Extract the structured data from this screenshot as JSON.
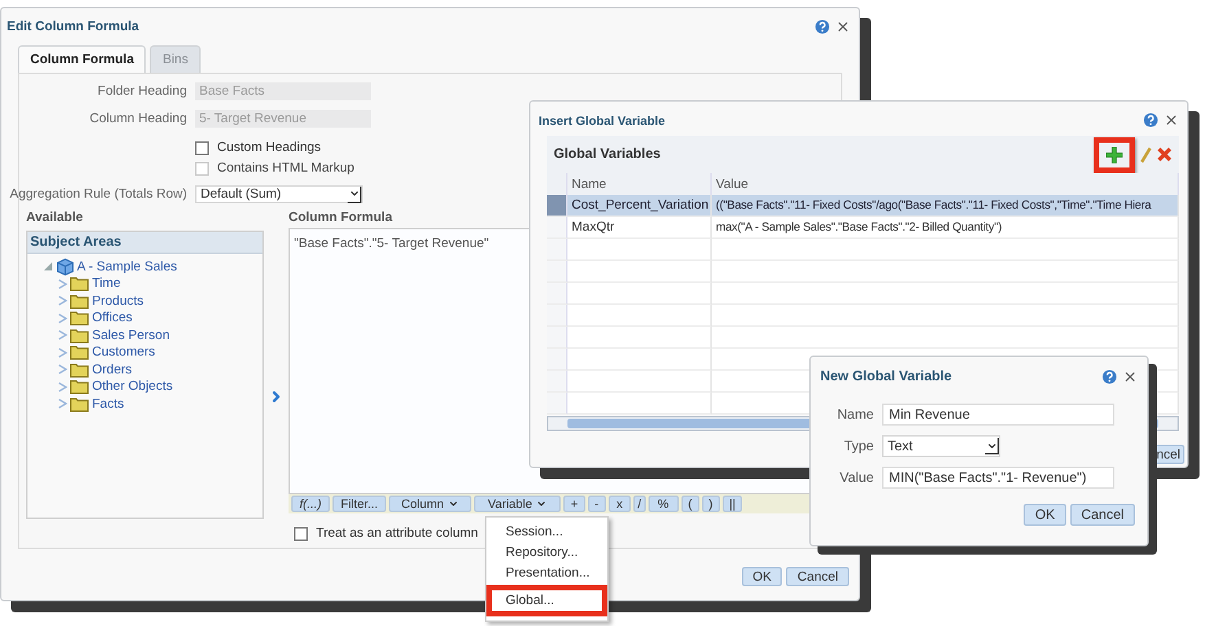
{
  "edit_dialog": {
    "title": "Edit Column Formula",
    "tabs": [
      {
        "label": "Column Formula",
        "selected": true
      },
      {
        "label": "Bins",
        "selected": false
      }
    ],
    "fields": [
      {
        "label": "Folder Heading",
        "value": "Base Facts"
      },
      {
        "label": "Column Heading",
        "value": "5- Target Revenue"
      }
    ],
    "options": [
      {
        "label": "Custom Headings",
        "checked": false,
        "disabled": false
      },
      {
        "label": "Contains HTML Markup",
        "checked": false,
        "disabled": true
      }
    ],
    "aggregation": {
      "label": "Aggregation Rule (Totals Row)",
      "value": "Default (Sum)"
    },
    "available": {
      "label": "Available",
      "tree_title": "Subject Areas",
      "root": {
        "label": "A - Sample Sales",
        "expanded": true,
        "children": [
          {
            "label": "Time",
            "expanded": false
          },
          {
            "label": "Products",
            "expanded": false
          },
          {
            "label": "Offices",
            "expanded": false
          },
          {
            "label": "Sales Person",
            "expanded": false
          },
          {
            "label": "Customers",
            "expanded": false
          },
          {
            "label": "Orders",
            "expanded": false
          },
          {
            "label": "Other Objects",
            "expanded": false
          },
          {
            "label": "Facts",
            "expanded": false
          }
        ]
      }
    },
    "formula": {
      "label": "Column Formula",
      "text": "\"Base Facts\".\"5- Target Revenue\"",
      "toolbar": [
        {
          "label": "f(...)",
          "kind": "italic"
        },
        {
          "label": "Filter...",
          "kind": "plain"
        },
        {
          "label": "Column",
          "kind": "menu"
        },
        {
          "label": "Variable",
          "kind": "menu"
        },
        {
          "label": "+",
          "kind": "plain"
        },
        {
          "label": "-",
          "kind": "plain"
        },
        {
          "label": "x",
          "kind": "plain"
        },
        {
          "label": "/",
          "kind": "plain"
        },
        {
          "label": "%",
          "kind": "plain"
        },
        {
          "label": "(",
          "kind": "plain"
        },
        {
          "label": ")",
          "kind": "plain"
        },
        {
          "label": "||",
          "kind": "plain"
        }
      ]
    },
    "attribute_option": {
      "label": "Treat as an attribute column",
      "checked": false
    },
    "variable_menu": [
      {
        "label": "Session...",
        "highlighted": false
      },
      {
        "label": "Repository...",
        "highlighted": false
      },
      {
        "label": "Presentation...",
        "highlighted": false
      },
      {
        "label": "Global...",
        "highlighted": true
      }
    ],
    "buttons": [
      "OK",
      "Cancel"
    ]
  },
  "insert_dialog": {
    "title": "Insert Global Variable",
    "grid_title": "Global Variables",
    "add_highlighted": true,
    "columns": [
      "Name",
      "Value"
    ],
    "rows": [
      {
        "name": "Cost_Percent_Variation",
        "value": "((\"Base Facts\".\"11- Fixed Costs\"/ago(\"Base Facts\".\"11- Fixed Costs\",\"Time\".\"Time Hiera",
        "selected": true
      },
      {
        "name": "MaxQtr",
        "value": "max(\"A - Sample Sales\".\"Base Facts\".\"2- Billed Quantity\")",
        "selected": false
      }
    ],
    "buttons": [
      "ncel"
    ]
  },
  "new_dialog": {
    "title": "New Global Variable",
    "fields": [
      {
        "label": "Name",
        "value": "Min Revenue",
        "kind": "text"
      },
      {
        "label": "Type",
        "value": "Text",
        "kind": "select"
      },
      {
        "label": "Value",
        "value": "MIN(\"Base Facts\".\"1- Revenue\")",
        "kind": "text"
      }
    ],
    "buttons": [
      "OK",
      "Cancel"
    ]
  }
}
